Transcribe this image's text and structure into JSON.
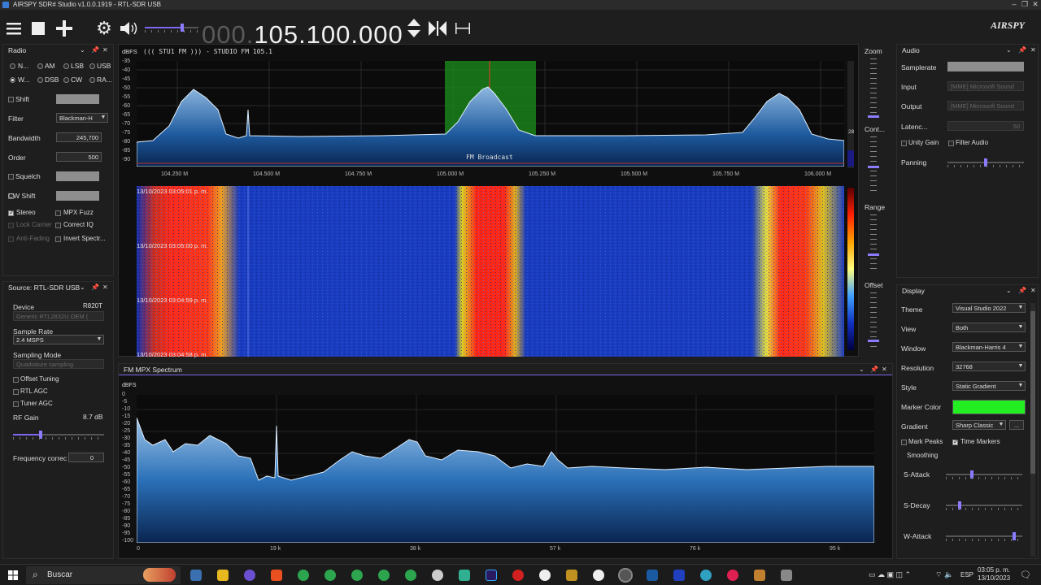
{
  "window": {
    "title": "AIRSPY SDR# Studio v1.0.0.1919 - RTL-SDR USB"
  },
  "toolbar": {
    "frequency_dim": "000.",
    "frequency": "105.100.000",
    "brand": "AIRSPY"
  },
  "radio": {
    "title": "Radio",
    "modes": [
      "N...",
      "AM",
      "LSB",
      "USB",
      "W...",
      "DSB",
      "CW",
      "RA..."
    ],
    "selected_mode": "W...",
    "shift_label": "Shift",
    "filter_label": "Filter",
    "filter_value": "Blackman-H",
    "bandwidth_label": "Bandwidth",
    "bandwidth_value": "245,700",
    "order_label": "Order",
    "order_value": "500",
    "squelch_label": "Squelch",
    "cw_shift_label": "CW Shift",
    "stereo_label": "Stereo",
    "mpx_fuzz_label": "MPX Fuzz",
    "lock_carrier_label": "Lock Carrier",
    "correct_iq_label": "Correct IQ",
    "anti_fading_label": "Anti-Fading",
    "invert_spectrum_label": "Invert Spectr..."
  },
  "source": {
    "title": "Source: RTL-SDR USB",
    "device_label": "Device",
    "device_tuner": "R820T",
    "device_value": "Generic RTL2832U OEM (",
    "sample_rate_label": "Sample Rate",
    "sample_rate_value": "2.4 MSPS",
    "sampling_mode_label": "Sampling Mode",
    "sampling_mode_value": "Quadrature sampling",
    "offset_tuning_label": "Offset Tuning",
    "rtl_agc_label": "RTL AGC",
    "tuner_agc_label": "Tuner AGC",
    "rf_gain_label": "RF Gain",
    "rf_gain_value": "8.7 dB",
    "rf_gain_level": 0.3,
    "freq_corr_label": "Frequency correc",
    "freq_corr_value": "0"
  },
  "spectrum": {
    "unit": "dBFS",
    "station": "(((  STU1 FM )))  - STUDIO FM 105.1",
    "y_ticks": [
      "-35",
      "-40",
      "-45",
      "-50",
      "-55",
      "-60",
      "-65",
      "-70",
      "-75",
      "-80",
      "-85",
      "-90"
    ],
    "x_ticks": [
      "104.250 M",
      "104.500 M",
      "104.750 M",
      "105.000 M",
      "105.250 M",
      "105.500 M",
      "105.750 M",
      "106.000 M"
    ],
    "band_label": "FM Broadcast",
    "side_number": "28"
  },
  "waterfall": {
    "time_markers": [
      "13/10/2023 03:05:01 p. m.",
      "13/10/2023 03:05:00 p. m.",
      "13/10/2023 03:04:59 p. m.",
      "13/10/2023 03:04:58 p. m."
    ]
  },
  "side_controls": {
    "zoom": "Zoom",
    "contrast": "Cont...",
    "range": "Range",
    "offset": "Offset"
  },
  "mpx": {
    "title": "FM MPX Spectrum",
    "unit": "dBFS",
    "y_ticks": [
      "0",
      "-5",
      "-10",
      "-15",
      "-20",
      "-25",
      "-30",
      "-35",
      "-40",
      "-45",
      "-50",
      "-55",
      "-60",
      "-65",
      "-70",
      "-75",
      "-80",
      "-85",
      "-90",
      "-95",
      "-100"
    ],
    "x_ticks": [
      "0",
      "19 k",
      "38 k",
      "57 k",
      "76 k",
      "95 k"
    ]
  },
  "audio": {
    "title": "Audio",
    "samplerate_label": "Samplerate",
    "input_label": "Input",
    "input_value": "[MME] Microsoft Sound",
    "output_label": "Output",
    "output_value": "[MME] Microsoft Sound",
    "latency_label": "Latenc...",
    "latency_value": "50",
    "unity_gain_label": "Unity Gain",
    "filter_audio_label": "Filter Audio",
    "panning_label": "Panning"
  },
  "display": {
    "title": "Display",
    "theme_label": "Theme",
    "theme_value": "Visual Studio 2022",
    "view_label": "View",
    "view_value": "Both",
    "window_label": "Window",
    "window_value": "Blackman-Harris 4",
    "resolution_label": "Resolution",
    "resolution_value": "32768",
    "style_label": "Style",
    "style_value": "Static Gradient",
    "marker_color_label": "Marker Color",
    "marker_color": "#22ee22",
    "gradient_label": "Gradient",
    "gradient_value": "Sharp Classic",
    "gradient_more": "...",
    "mark_peaks_label": "Mark Peaks",
    "time_markers_label": "Time Markers",
    "smoothing_label": "Smoothing",
    "s_attack_label": "S-Attack",
    "s_decay_label": "S-Decay",
    "w_attack_label": "W-Attack"
  },
  "taskbar": {
    "search_placeholder": "Buscar",
    "language": "ESP",
    "time": "03:05 p. m.",
    "date": "13/10/2023"
  }
}
